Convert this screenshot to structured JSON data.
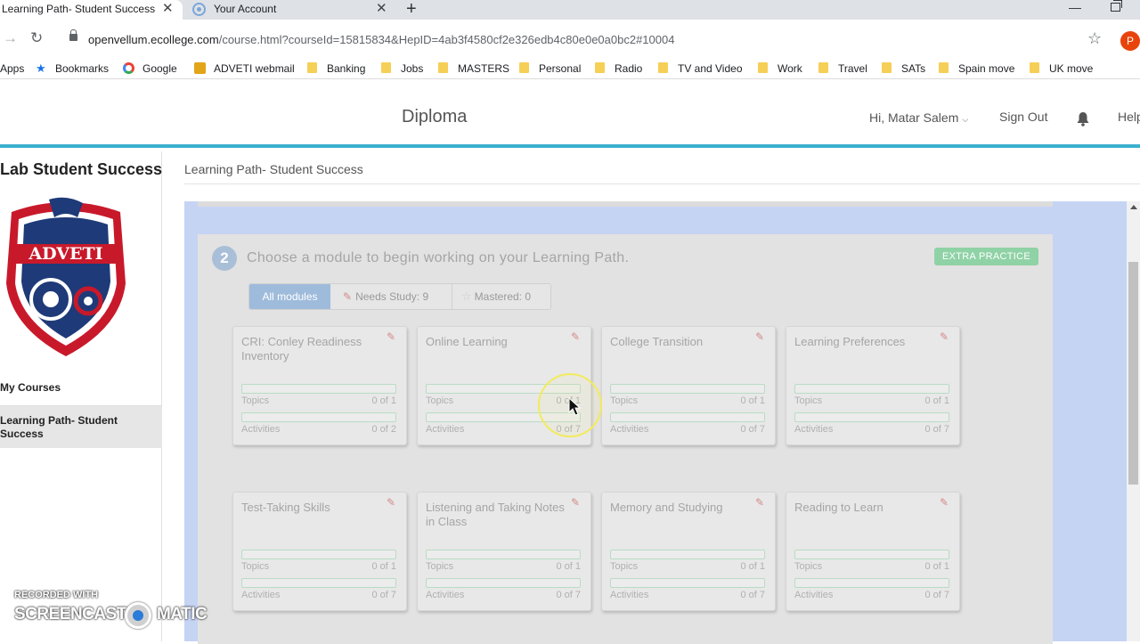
{
  "browser": {
    "tabs": [
      {
        "title": "Learning Path- Student Success",
        "active": true
      },
      {
        "title": "Your Account",
        "active": false
      }
    ],
    "close_glyph": "✕",
    "new_tab_glyph": "+",
    "url_host": "openvellum.ecollege.com",
    "url_path": "/course.html?courseId=15815834&HepID=4ab3f4580cf2e326edb4c80e0e0a0bc2#10004",
    "profile_initial": "P",
    "bookmarks": [
      {
        "label": "Apps",
        "icon": "apps-icon"
      },
      {
        "label": "Bookmarks",
        "icon": "star-icon"
      },
      {
        "label": "Google",
        "icon": "google-icon"
      },
      {
        "label": "ADVETI webmail",
        "icon": "mail-icon"
      },
      {
        "label": "Banking",
        "icon": "folder-icon"
      },
      {
        "label": "Jobs",
        "icon": "folder-icon"
      },
      {
        "label": "MASTERS",
        "icon": "folder-icon"
      },
      {
        "label": "Personal",
        "icon": "folder-icon"
      },
      {
        "label": "Radio",
        "icon": "folder-icon"
      },
      {
        "label": "TV and Video",
        "icon": "folder-icon"
      },
      {
        "label": "Work",
        "icon": "folder-icon"
      },
      {
        "label": "Travel",
        "icon": "folder-icon"
      },
      {
        "label": "SATs",
        "icon": "folder-icon"
      },
      {
        "label": "Spain move",
        "icon": "folder-icon"
      },
      {
        "label": "UK move",
        "icon": "folder-icon"
      }
    ]
  },
  "header": {
    "course_title": "Diploma",
    "greeting": "Hi, Matar Salem",
    "sign_out": "Sign Out",
    "help": "Help"
  },
  "sidebar": {
    "title": "Lab Student Success",
    "logo_text": "ADVETI",
    "my_courses": "My Courses",
    "active_item": "Learning Path- Student Success"
  },
  "main": {
    "breadcrumb": "Learning Path- Student Success",
    "step_number": "2",
    "step_text": "Choose a module to begin working on your Learning Path.",
    "extra_practice": "EXTRA PRACTICE",
    "filters": {
      "all": "All modules",
      "needs_study": "Needs Study: 9",
      "mastered": "Mastered: 0"
    },
    "modules": [
      {
        "title": "CRI: Conley Readiness Inventory",
        "topics_label": "Topics",
        "topics": "0 of 1",
        "activities_label": "Activities",
        "activities": "0 of 2"
      },
      {
        "title": "Online Learning",
        "topics_label": "Topics",
        "topics": "0 of 1",
        "activities_label": "Activities",
        "activities": "0 of 7"
      },
      {
        "title": "College Transition",
        "topics_label": "Topics",
        "topics": "0 of 1",
        "activities_label": "Activities",
        "activities": "0 of 7"
      },
      {
        "title": "Learning Preferences",
        "topics_label": "Topics",
        "topics": "0 of 1",
        "activities_label": "Activities",
        "activities": "0 of 7"
      },
      {
        "title": "Test-Taking Skills",
        "topics_label": "Topics",
        "topics": "0 of 1",
        "activities_label": "Activities",
        "activities": "0 of 7"
      },
      {
        "title": "Listening and Taking Notes in Class",
        "topics_label": "Topics",
        "topics": "0 of 1",
        "activities_label": "Activities",
        "activities": "0 of 7"
      },
      {
        "title": "Memory and Studying",
        "topics_label": "Topics",
        "topics": "0 of 1",
        "activities_label": "Activities",
        "activities": "0 of 7"
      },
      {
        "title": "Reading to Learn",
        "topics_label": "Topics",
        "topics": "0 of 1",
        "activities_label": "Activities",
        "activities": "0 of 7"
      }
    ]
  },
  "watermark": {
    "top": "RECORDED WITH",
    "left": "SCREENCAST",
    "right": "MATIC"
  },
  "colors": {
    "header_accent": "#3bb0cf",
    "stage_bg": "#c6d4f4",
    "extra_practice": "#8fd2a6",
    "filter_active": "#9fbbdb"
  }
}
